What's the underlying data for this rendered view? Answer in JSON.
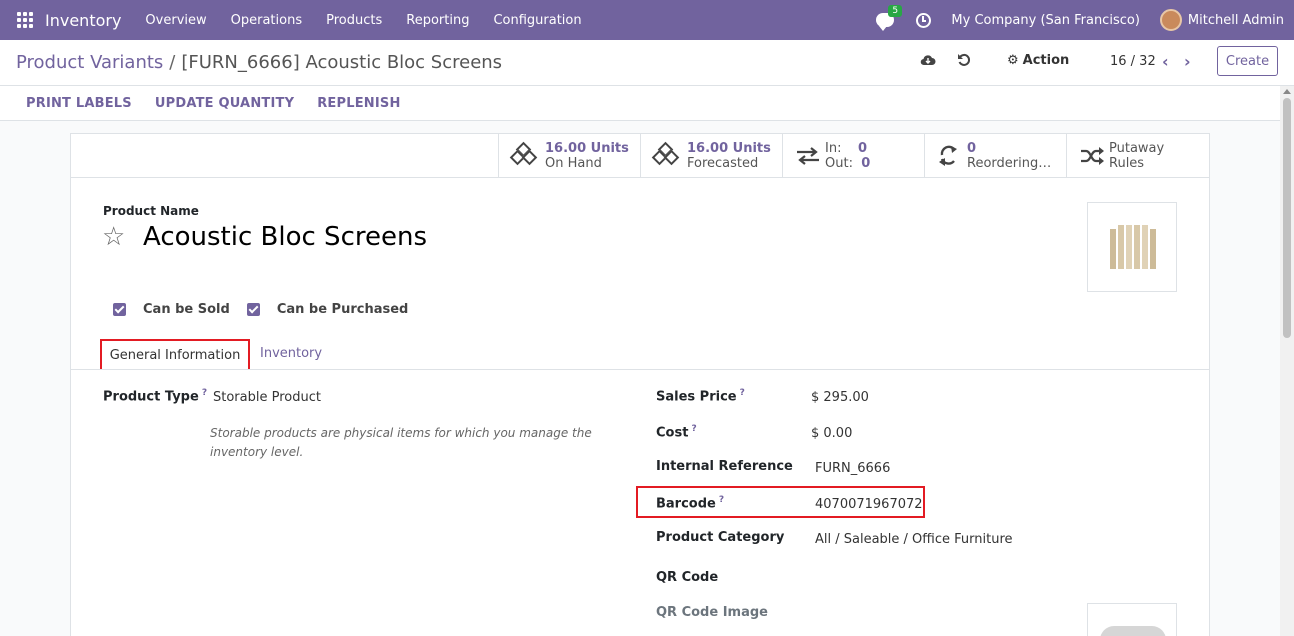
{
  "navbar": {
    "app_name": "Inventory",
    "menu": [
      "Overview",
      "Operations",
      "Products",
      "Reporting",
      "Configuration"
    ],
    "chat_count": "5",
    "company": "My Company (San Francisco)",
    "user": "Mitchell Admin",
    "accent": "#71639e"
  },
  "control": {
    "breadcrumb_parent": "Product Variants",
    "breadcrumb_sep": "/",
    "breadcrumb_current": "[FURN_6666] Acoustic Bloc Screens",
    "action_label": "Action",
    "pager": "16 / 32",
    "create_label": "Create"
  },
  "actions": [
    "PRINT LABELS",
    "UPDATE QUANTITY",
    "REPLENISH"
  ],
  "smart_buttons": {
    "on_hand_value": "16.00 Units",
    "on_hand_label": "On Hand",
    "forecast_value": "16.00 Units",
    "forecast_label": "Forecasted",
    "in_label": "In:",
    "in_value": "0",
    "out_label": "Out:",
    "out_value": "0",
    "reorder_value": "0",
    "reorder_label": "Reordering…",
    "putaway_line1": "Putaway",
    "putaway_line2": "Rules"
  },
  "product": {
    "name_label": "Product Name",
    "name": "Acoustic Bloc Screens",
    "can_be_sold": "Can be Sold",
    "can_be_purchased": "Can be Purchased"
  },
  "tabs": {
    "general": "General Information",
    "inventory": "Inventory"
  },
  "fields": {
    "product_type_label": "Product Type",
    "product_type": "Storable Product",
    "product_type_help": "Storable products are physical items for which you manage the inventory level.",
    "sales_price_label": "Sales Price",
    "sales_price": "$ 295.00",
    "cost_label": "Cost",
    "cost": "$ 0.00",
    "internal_ref_label": "Internal Reference",
    "internal_ref": "FURN_6666",
    "barcode_label": "Barcode",
    "barcode": "4070071967072",
    "category_label": "Product Category",
    "category": "All / Saleable / Office Furniture",
    "qr_code_label": "QR Code",
    "qr_image_label": "QR Code Image",
    "help_mark": "?"
  }
}
